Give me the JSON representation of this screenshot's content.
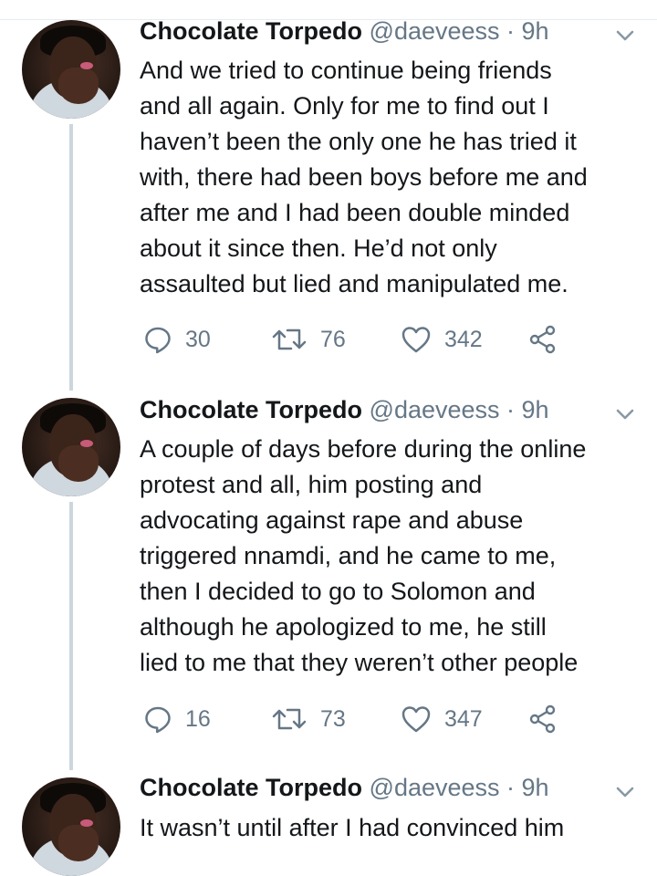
{
  "tweets": [
    {
      "display_name": "Chocolate Torpedo",
      "handle": "@daeveess",
      "time": "9h",
      "lines": [
        "And we tried to continue being friends",
        "and all again. Only for me to find out I",
        "haven’t been the only one he has tried it",
        "with, there had been boys before me and",
        "after me and I had been double minded",
        "about it since then. He’d not only",
        "assaulted but lied and manipulated me."
      ],
      "replies": "30",
      "retweets": "76",
      "likes": "342"
    },
    {
      "display_name": "Chocolate Torpedo",
      "handle": "@daeveess",
      "time": "9h",
      "lines": [
        "A couple of days before during the online",
        "protest and all, him posting and",
        "advocating against rape and abuse",
        "triggered nnamdi, and he came to me,",
        "then I decided to go to Solomon and",
        "although he apologized to me, he still",
        "lied to me that they weren’t other people"
      ],
      "replies": "16",
      "retweets": "73",
      "likes": "347"
    },
    {
      "display_name": "Chocolate Torpedo",
      "handle": "@daeveess",
      "time": "9h",
      "lines": [
        "It wasn’t until after I had convinced him"
      ]
    }
  ],
  "icons": {
    "reply": "reply-bubble-icon",
    "retweet": "retweet-arrows-icon",
    "like": "heart-icon",
    "share": "share-icon",
    "menu": "chevron-down-icon"
  },
  "colors": {
    "text": "#14171a",
    "muted": "#657786",
    "thread_line": "#ccd6dd"
  }
}
